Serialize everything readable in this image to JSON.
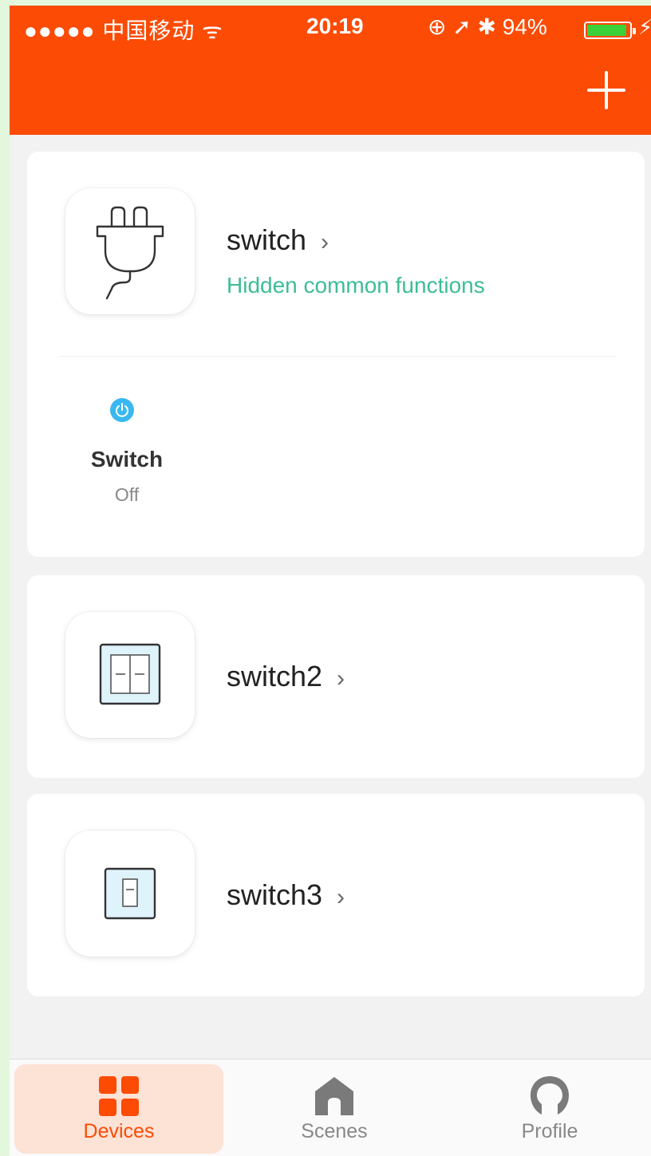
{
  "status_bar": {
    "signal": "●●●●● 中国移动 ᯤ",
    "time": "20:19",
    "indicators": "⊕ ➚ ✱ 94%",
    "battery_percent": 94
  },
  "header": {
    "add_icon": "plus-icon"
  },
  "devices": [
    {
      "name": "switch",
      "chevron": "›",
      "hint": "Hidden common functions",
      "icon": "plug-icon",
      "function": {
        "name": "Switch",
        "state": "Off",
        "icon": "power-icon"
      }
    },
    {
      "name": "switch2",
      "chevron": "›",
      "icon": "double-switch-icon"
    },
    {
      "name": "switch3",
      "chevron": "›",
      "icon": "single-switch-icon"
    }
  ],
  "tabs": [
    {
      "label": "Devices",
      "icon": "grid-icon",
      "active": true
    },
    {
      "label": "Scenes",
      "icon": "home-icon",
      "active": false
    },
    {
      "label": "Profile",
      "icon": "profile-icon",
      "active": false
    }
  ],
  "colors": {
    "accent": "#fc4b04",
    "hint": "#3dbd95",
    "power": "#3ab8f0",
    "tab_inactive": "#888888"
  }
}
